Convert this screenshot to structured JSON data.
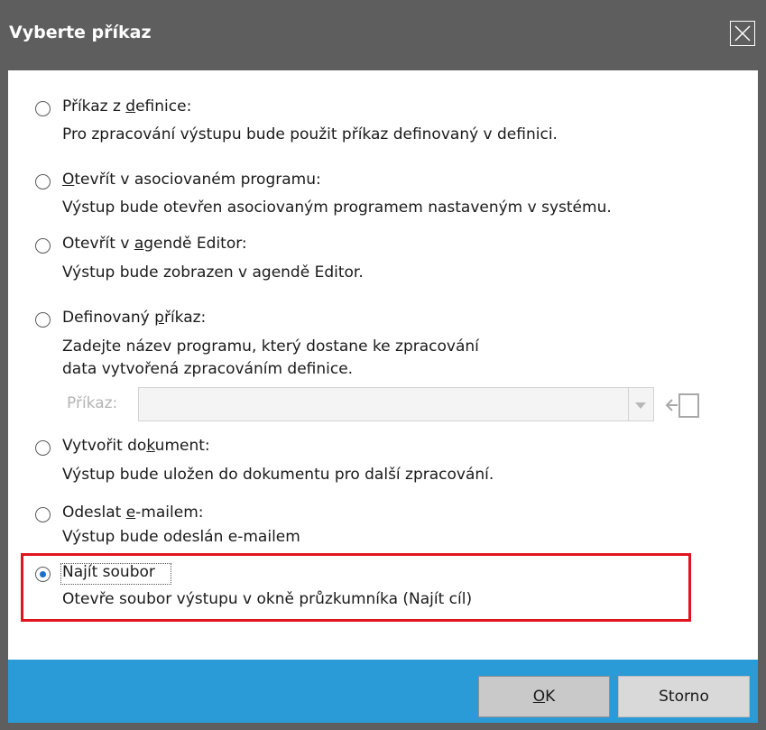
{
  "dialog": {
    "title": "Vyberte příkaz"
  },
  "options": [
    {
      "label_pre": "Příkaz z ",
      "label_u": "d",
      "label_post": "efinice:",
      "desc": [
        "Pro zpracování výstupu bude použit příkaz definovaný v definici."
      ],
      "checked": false
    },
    {
      "label_pre": "",
      "label_u": "O",
      "label_post": "tevřít v asociovaném programu:",
      "desc": [
        "Výstup bude otevřen asociovaným programem nastaveným v systému."
      ],
      "checked": false
    },
    {
      "label_pre": "Otevřít v ",
      "label_u": "a",
      "label_post": "gendě Editor:",
      "desc": [
        "Výstup bude zobrazen v agendě Editor."
      ],
      "checked": false
    },
    {
      "label_pre": "Definovaný ",
      "label_u": "p",
      "label_post": "říkaz:",
      "desc": [
        "Zadejte název programu, který dostane ke zpracování",
        "data vytvořená zpracováním definice."
      ],
      "checked": false
    },
    {
      "label_pre": "Vytvořit do",
      "label_u": "k",
      "label_post": "ument:",
      "desc": [
        "Výstup bude uložen do dokumentu pro další zpracování."
      ],
      "checked": false
    },
    {
      "label_pre": "Odeslat ",
      "label_u": "e",
      "label_post": "-mailem:",
      "desc": [
        "Výstup bude odeslán e-mailem"
      ],
      "checked": false
    },
    {
      "label_pre": "Na",
      "label_u": "j",
      "label_post": "ít soubor",
      "desc": [
        "Otevře soubor výstupu v okně průzkumníka (Najít cíl)"
      ],
      "checked": true
    }
  ],
  "command": {
    "label": "Příkaz:",
    "value": ""
  },
  "buttons": {
    "ok_u": "O",
    "ok_rest": "K",
    "cancel": "Storno"
  },
  "colors": {
    "titlebar": "#5e5e5e",
    "footer": "#2a9bd6",
    "highlight": "#e0141e",
    "radio_dot": "#1e6fc8"
  }
}
